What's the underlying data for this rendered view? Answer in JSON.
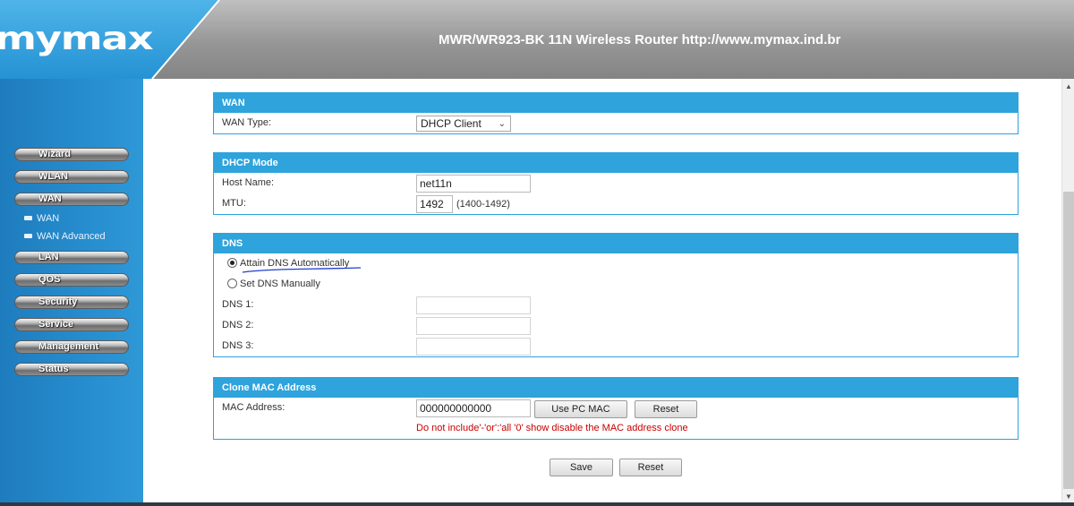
{
  "header": {
    "logo_text": "mymax",
    "title": "MWR/WR923-BK 11N Wireless Router http://www.mymax.ind.br",
    "colors": {
      "brand_blue": "#2ea3dc",
      "header_gray": "#9a9a9a"
    }
  },
  "sidebar": {
    "items": [
      {
        "label": "Wizard"
      },
      {
        "label": "WLAN"
      },
      {
        "label": "WAN"
      }
    ],
    "wan_sub_items": [
      {
        "label": "WAN"
      },
      {
        "label": "WAN Advanced"
      }
    ],
    "items_after": [
      {
        "label": "LAN"
      },
      {
        "label": "QOS"
      },
      {
        "label": "Security"
      },
      {
        "label": "Service"
      },
      {
        "label": "Management"
      },
      {
        "label": "Status"
      }
    ]
  },
  "wan": {
    "heading": "WAN",
    "type_label": "WAN Type:",
    "type_value": "DHCP Client"
  },
  "dhcp": {
    "heading": "DHCP Mode",
    "host_label": "Host Name:",
    "host_value": "net11n",
    "mtu_label": "MTU:",
    "mtu_value": "1492",
    "mtu_hint": "(1400-1492)"
  },
  "dns": {
    "heading": "DNS",
    "auto_label": "Attain DNS Automatically",
    "manual_label": "Set DNS Manually",
    "selected": "auto",
    "dns1_label": "DNS 1:",
    "dns2_label": "DNS 2:",
    "dns3_label": "DNS 3:",
    "dns1_value": "",
    "dns2_value": "",
    "dns3_value": ""
  },
  "clone": {
    "heading": "Clone MAC Address",
    "mac_label": "MAC Address:",
    "mac_value": "000000000000",
    "use_pc_mac_label": "Use PC MAC",
    "reset_label": "Reset",
    "warning": "Do not include'-'or':'all '0' show disable the MAC address clone",
    "warning_color": "#c80000"
  },
  "footer": {
    "save_label": "Save",
    "reset_label": "Reset"
  }
}
